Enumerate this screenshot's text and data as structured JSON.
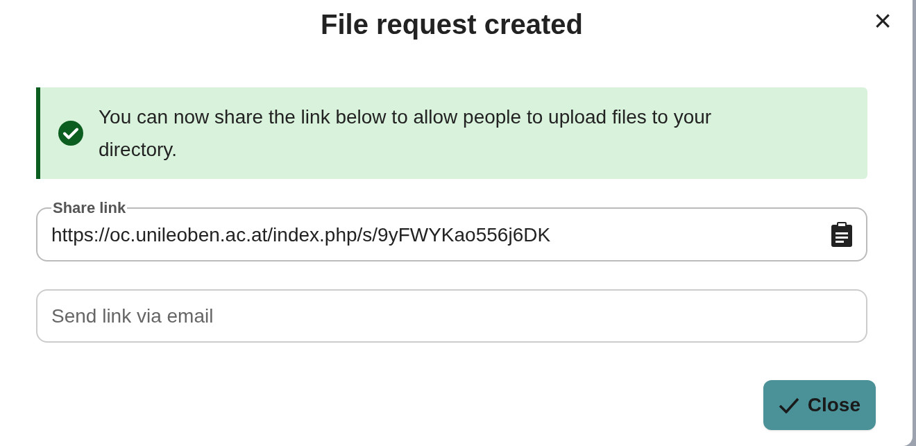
{
  "dialog": {
    "title": "File request created",
    "close_icon": "×"
  },
  "alert": {
    "kind": "success",
    "message": "You can now share the link below to allow people to upload files to your directory."
  },
  "share_link": {
    "label": "Share link",
    "value": "https://oc.unileoben.ac.at/index.php/s/9yFWYKao556j6DK"
  },
  "email": {
    "placeholder": "Send link via email"
  },
  "buttons": [
    {
      "label": "Close"
    }
  ]
}
